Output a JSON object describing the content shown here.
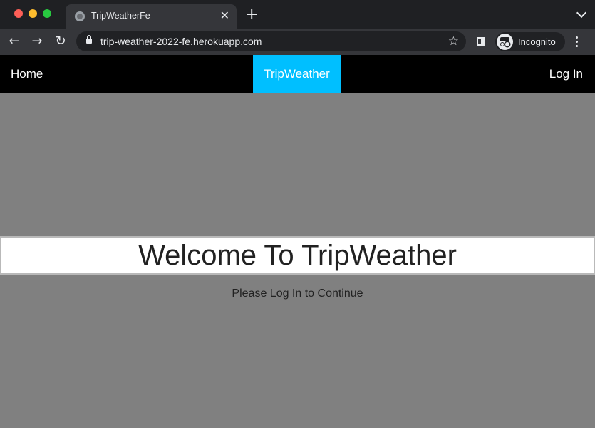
{
  "browser": {
    "tab_title": "TripWeatherFe",
    "tab_close": "✕",
    "new_tab": "+",
    "url": "trip-weather-2022-fe.herokuapp.com",
    "profile_label": "Incognito",
    "nav_back": "←",
    "nav_forward": "→",
    "nav_reload": "↻",
    "star": "☆"
  },
  "navbar": {
    "home": "Home",
    "brand": "TripWeather",
    "login": "Log In"
  },
  "main": {
    "title": "Welcome To TripWeather",
    "prompt": "Please Log In to Continue"
  },
  "colors": {
    "page_bg": "#808080",
    "navbar_bg": "#000000",
    "brand_bg": "#00bfff"
  }
}
